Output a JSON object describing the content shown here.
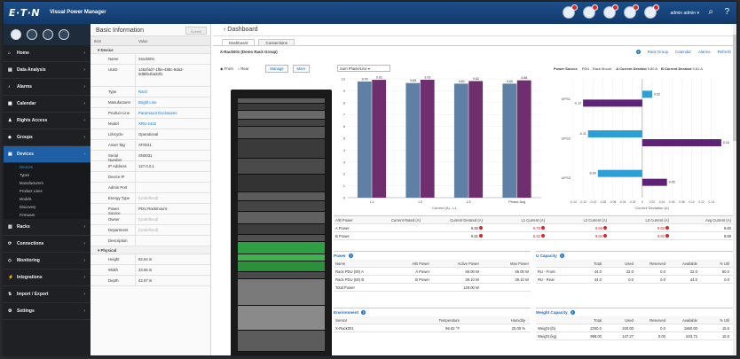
{
  "header": {
    "logo": "E·T·N",
    "app_title": "Visual Power Manager",
    "user": "admin admin",
    "alert_count": 4
  },
  "sidebar": {
    "items": [
      {
        "label": "Home",
        "icon": "home-icon"
      },
      {
        "label": "Data Analysis",
        "icon": "chart-icon"
      },
      {
        "label": "Alarms",
        "icon": "bell-icon"
      },
      {
        "label": "Calendar",
        "icon": "calendar-icon"
      },
      {
        "label": "Rights Access",
        "icon": "user-icon"
      },
      {
        "label": "Groups",
        "icon": "groups-icon"
      },
      {
        "label": "Devices",
        "icon": "devices-icon",
        "active": true
      }
    ],
    "sub_items": [
      "Devices",
      "Types",
      "Manufacturers",
      "Product Lines",
      "Models",
      "Discovery",
      "Firmware"
    ],
    "items_after": [
      {
        "label": "Racks",
        "icon": "rack-icon"
      },
      {
        "label": "Connections",
        "icon": "link-icon"
      },
      {
        "label": "Monitoring",
        "icon": "monitor-icon"
      },
      {
        "label": "Integrations",
        "icon": "plug-icon"
      },
      {
        "label": "Import / Export",
        "icon": "import-icon"
      },
      {
        "label": "Settings",
        "icon": "gear-icon"
      }
    ]
  },
  "basic_info": {
    "title": "Basic Information",
    "submit_label": "Submit",
    "col_item": "Item",
    "col_value": "Value",
    "group_device": "Device",
    "group_physical": "Physical",
    "rows": [
      {
        "k": "Name",
        "v": "Xrack001",
        "style": ""
      },
      {
        "k": "UUID",
        "v": "1452f4d7-1f5e-488c-9da2-0d9bb4ba33f1",
        "style": ""
      },
      {
        "k": "Type",
        "v": "Rack",
        "style": "link"
      },
      {
        "k": "Manufacturer",
        "v": "Bright Line",
        "style": "link"
      },
      {
        "k": "Product Line",
        "v": "Paramount Enclosures",
        "style": "link"
      },
      {
        "k": "Model",
        "v": "XRU-2442",
        "style": "link"
      },
      {
        "k": "Lifecycle",
        "v": "Operational",
        "style": ""
      },
      {
        "k": "Asset Tag",
        "v": "AT0031",
        "style": ""
      },
      {
        "k": "Serial Number",
        "v": "SN0031",
        "style": ""
      },
      {
        "k": "IP Address",
        "v": "127.0.0.1",
        "style": ""
      },
      {
        "k": "Device IP",
        "v": "",
        "style": ""
      },
      {
        "k": "Admin Port",
        "v": "",
        "style": ""
      },
      {
        "k": "Energy Type",
        "v": "(Undefined)",
        "style": "muted"
      },
      {
        "k": "Power Source",
        "v": "PDU Rackmount",
        "style": ""
      },
      {
        "k": "Owner",
        "v": "(Undefined)",
        "style": "muted"
      },
      {
        "k": "Department",
        "v": "(Undefined)",
        "style": "muted"
      },
      {
        "k": "Description",
        "v": "",
        "style": ""
      }
    ],
    "physical_rows": [
      {
        "k": "Height",
        "v": "82.84 in"
      },
      {
        "k": "Width",
        "v": "23.66 in"
      },
      {
        "k": "Depth",
        "v": "42.97 in"
      }
    ]
  },
  "dashboard": {
    "title": "Dashboard",
    "tabs": [
      "Dashboard",
      "Connections"
    ],
    "breadcrumb": "X-Rack001 (Demo Rack Group)",
    "links": [
      "Rack Group",
      "Calendar",
      "Alarms",
      "Refresh"
    ],
    "rack_front": "Front",
    "rack_rear": "Rear",
    "manage_label": "Manage",
    "more_label": "More",
    "select_value": "Sum Phase/Line",
    "power_source_label": "Power Source",
    "power_source_value": "PDU - Rack Mount",
    "legend_a": "A Current Derated",
    "legend_a_val": "9.80 A",
    "legend_b": "B Current Derated",
    "legend_b_val": "9.81 A"
  },
  "chart_data": [
    {
      "type": "bar",
      "categories": [
        "L1",
        "L2",
        "L3",
        "Phase Avg"
      ],
      "series": [
        {
          "name": "",
          "values": [
            9.78,
            9.65,
            9.6,
            9.6
          ],
          "color": "#5f7fa4"
        },
        {
          "name": "",
          "values": [
            9.92,
            9.93,
            9.82,
            9.88
          ],
          "color": "#6f2e6e"
        }
      ],
      "labels_a": [
        "9.78",
        "9.65",
        "9.60",
        "9.60"
      ],
      "labels_b": [
        "9.92",
        "9.93",
        "9.82",
        "9.88"
      ],
      "ylim": [
        0,
        10
      ],
      "yticks": [
        "0",
        "1",
        "2",
        "3",
        "4",
        "5",
        "6",
        "7",
        "8",
        "9",
        "10"
      ],
      "xlabel": "Current (A) - L1",
      "ylabel": ""
    },
    {
      "type": "bar",
      "orientation": "horizontal",
      "categories": [
        "UPS1",
        "UPS2",
        "UPS3"
      ],
      "series": [
        {
          "name": "",
          "values": [
            0.02,
            -0.11,
            -0.09
          ],
          "color": "#2e9fd4"
        },
        {
          "name": "",
          "values": [
            -0.12,
            0.16,
            0.05
          ],
          "color": "#5e2377"
        }
      ],
      "labels_a": [
        "0.02",
        "-0.11",
        "-0.09"
      ],
      "labels_b": [
        "-0.12",
        "0.16",
        "0.05"
      ],
      "xlim": [
        -0.14,
        0.18
      ],
      "xticks": [
        "-0.14",
        "-0.12",
        "-0.10",
        "-0.08",
        "-0.06",
        "-0.04",
        "-0.02",
        "0",
        "0.02",
        "0.04",
        "0.06",
        "0.08",
        "0.10",
        "0.12",
        "0.14"
      ],
      "xlabel": "Current Deviation (A)"
    }
  ],
  "phase_table": {
    "head": [
      "A/B Power",
      "Current Rated (A)",
      "Current Derated (A)",
      "L1 Current (A)",
      "L2 Current (A)",
      "L3 Current (A)",
      "Avg Current (A)"
    ],
    "rows": [
      [
        "A Power",
        "",
        "9.80",
        "9.78",
        "9.65",
        "9.60",
        "9.60"
      ],
      [
        "B Power",
        "",
        "9.81",
        "9.92",
        "9.93",
        "9.82",
        "9.88"
      ]
    ]
  },
  "power": {
    "title": "Power",
    "head": [
      "Name",
      "A/B Power",
      "Active Power",
      "Max Power"
    ],
    "rows": [
      [
        "Rack PDU (00) A",
        "A Power",
        "86.00 W",
        "86.00 W"
      ],
      [
        "Rack PDU (00) B",
        "B Power",
        "39.10 W",
        "39.10 W"
      ],
      [
        "Total Power",
        "",
        "128.00 W",
        ""
      ]
    ]
  },
  "ucapacity": {
    "title": "U Capacity",
    "head": [
      "",
      "Total",
      "Used",
      "Reserved",
      "Available",
      "% Util"
    ],
    "rows": [
      [
        "RU - Front",
        "44.0",
        "22.0",
        "0.0",
        "22.0",
        "50.0"
      ],
      [
        "RU - Rear",
        "44.0",
        "0.0",
        "0.0",
        "44.0",
        "0.0"
      ]
    ]
  },
  "environment": {
    "title": "Environment",
    "head": [
      "Sensor",
      "Temperature",
      "Humidity"
    ],
    "rows": [
      [
        "X-Rack001",
        "86.62 °F",
        "20.00 %"
      ]
    ]
  },
  "weight": {
    "title": "Weight Capacity",
    "head": [
      "",
      "Total",
      "Used",
      "Reserved",
      "Available",
      "% Util"
    ],
    "rows": [
      [
        "Weight (lb)",
        "2200.0",
        "340.00",
        "0.0",
        "1860.00",
        "15.5"
      ],
      [
        "Weight (kg)",
        "998.00",
        "147.27",
        "0.00",
        "843.73",
        "15.5"
      ]
    ]
  }
}
